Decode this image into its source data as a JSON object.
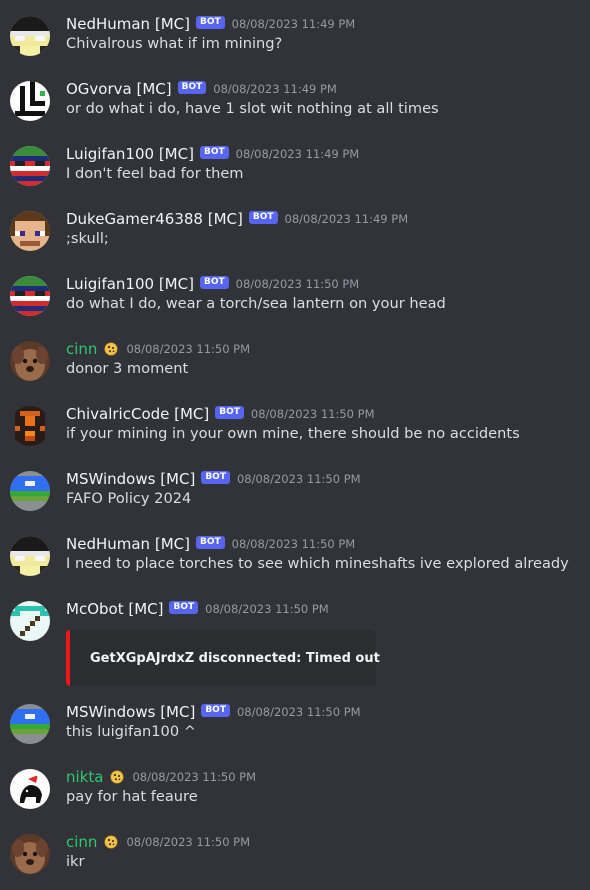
{
  "channel": {
    "messages": [
      {
        "author": "NedHuman [MC]",
        "badge": "BOT",
        "timestamp": "08/08/2023 11:49 PM",
        "text": "Chivalrous what if im mining?",
        "avatar_icon": "minecraft-skin-nedhuman-icon"
      },
      {
        "author": "OGvorva [MC]",
        "badge": "BOT",
        "timestamp": "08/08/2023 11:49 PM",
        "text": "or do what i do, have 1 slot wit nothing at all times",
        "avatar_icon": "minecraft-skin-ogvorva-icon"
      },
      {
        "author": "Luigifan100 [MC]",
        "badge": "BOT",
        "timestamp": "08/08/2023 11:49 PM",
        "text": "I don't feel bad for them",
        "avatar_icon": "minecraft-skin-luigifan-icon"
      },
      {
        "author": "DukeGamer46388 [MC]",
        "badge": "BOT",
        "timestamp": "08/08/2023 11:49 PM",
        "text": ";skull;",
        "avatar_icon": "minecraft-skin-dukegamer-icon"
      },
      {
        "author": "Luigifan100 [MC]",
        "badge": "BOT",
        "timestamp": "08/08/2023 11:50 PM",
        "text": "do what I do, wear a torch/sea lantern on your head",
        "avatar_icon": "minecraft-skin-luigifan-icon"
      },
      {
        "author": "cinn",
        "badge": "",
        "timestamp": "08/08/2023 11:50 PM",
        "text": "donor 3 moment",
        "avatar_icon": "dog-photo-avatar-icon",
        "role_icon": "cookie-icon"
      },
      {
        "author": "ChivalricCode [MC]",
        "badge": "BOT",
        "timestamp": "08/08/2023 11:50 PM",
        "text": "if your mining in your own mine, there should be no accidents",
        "avatar_icon": "minecraft-skin-chivalriccode-icon"
      },
      {
        "author": "MSWindows [MC]",
        "badge": "BOT",
        "timestamp": "08/08/2023 11:50 PM",
        "text": "FAFO Policy 2024",
        "avatar_icon": "minecraft-skin-mswindows-icon"
      },
      {
        "author": "NedHuman [MC]",
        "badge": "BOT",
        "timestamp": "08/08/2023 11:50 PM",
        "text": "I need to place torches to see which mineshafts ive explored already",
        "avatar_icon": "minecraft-skin-nedhuman-icon"
      },
      {
        "author": "McObot [MC]",
        "badge": "BOT",
        "timestamp": "08/08/2023 11:50 PM",
        "text": "",
        "avatar_icon": "diamond-pickaxe-icon",
        "embed": {
          "text": "GetXGpAJrdxZ disconnected: Timed out",
          "accent": "#ED1717",
          "icon": "minecraft-player-head-icon"
        }
      },
      {
        "author": "MSWindows [MC]",
        "badge": "BOT",
        "timestamp": "08/08/2023 11:50 PM",
        "text": "this luigifan100 ^",
        "avatar_icon": "minecraft-skin-mswindows-icon"
      },
      {
        "author": "nikta",
        "badge": "",
        "timestamp": "08/08/2023 11:50 PM",
        "text": "pay for hat feaure",
        "avatar_icon": "cat-with-santa-hat-avatar-icon",
        "role_icon": "cookie-icon"
      },
      {
        "author": "cinn",
        "badge": "",
        "timestamp": "08/08/2023 11:50 PM",
        "text": "ikr",
        "avatar_icon": "dog-photo-avatar-icon",
        "role_icon": "cookie-icon"
      }
    ]
  },
  "colors": {
    "background": "#313338",
    "bot_badge": "#5865F2",
    "member_name": "#2DC770",
    "timestamp": "#949BA4"
  }
}
